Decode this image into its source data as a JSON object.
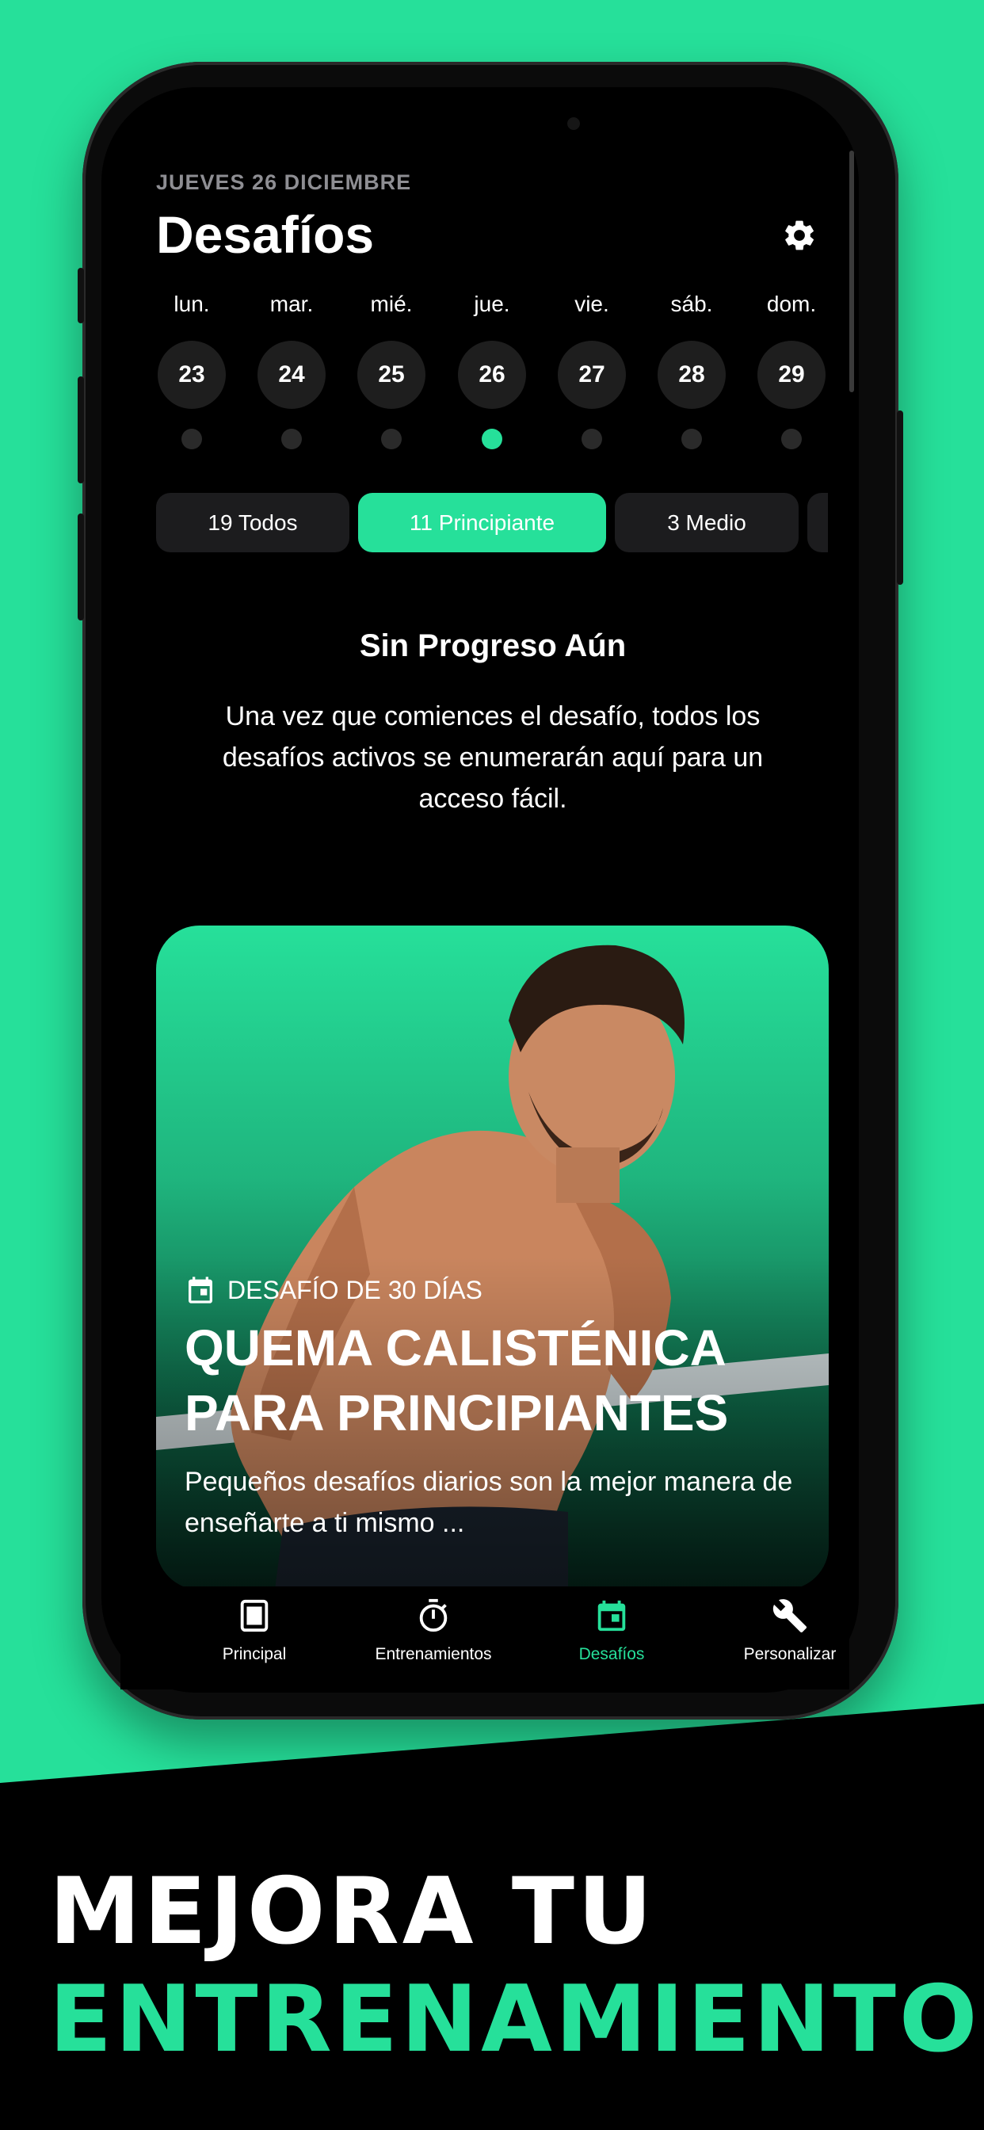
{
  "header": {
    "date_label": "JUEVES 26 DICIEMBRE",
    "title": "Desafíos",
    "settings_icon": "gear-icon"
  },
  "week": [
    {
      "name": "lun.",
      "day": "23",
      "active": false
    },
    {
      "name": "mar.",
      "day": "24",
      "active": false
    },
    {
      "name": "mié.",
      "day": "25",
      "active": false
    },
    {
      "name": "jue.",
      "day": "26",
      "active": true
    },
    {
      "name": "vie.",
      "day": "27",
      "active": false
    },
    {
      "name": "sáb.",
      "day": "28",
      "active": false
    },
    {
      "name": "dom.",
      "day": "29",
      "active": false
    }
  ],
  "filters": [
    {
      "label": "19 Todos",
      "active": false
    },
    {
      "label": "11 Principiante",
      "active": true
    },
    {
      "label": "3 Medio",
      "active": false
    }
  ],
  "empty_state": {
    "title": "Sin Progreso Aún",
    "text": "Una vez que comiences el desafío, todos los desafíos activos se enumerarán aquí para un acceso fácil."
  },
  "card": {
    "tag": "DESAFÍO DE 30 DÍAS",
    "tag_icon": "calendar-icon",
    "title": "QUEMA CALISTÉNICA PARA PRINCIPIANTES",
    "description": "Pequeños desafíos diarios son la mejor manera de enseñarte a ti mismo ..."
  },
  "tabs": [
    {
      "label": "Principal",
      "icon": "home-icon",
      "active": false
    },
    {
      "label": "Entrenamientos",
      "icon": "stopwatch-icon",
      "active": false
    },
    {
      "label": "Desafíos",
      "icon": "calendar-icon",
      "active": true
    },
    {
      "label": "Personalizar",
      "icon": "wrench-icon",
      "active": false
    }
  ],
  "promo": {
    "line1": "MEJORA TU",
    "line2": "ENTRENAMIENTO"
  },
  "colors": {
    "accent": "#26E09A",
    "background": "#000000",
    "surface": "#1c1c1e"
  }
}
